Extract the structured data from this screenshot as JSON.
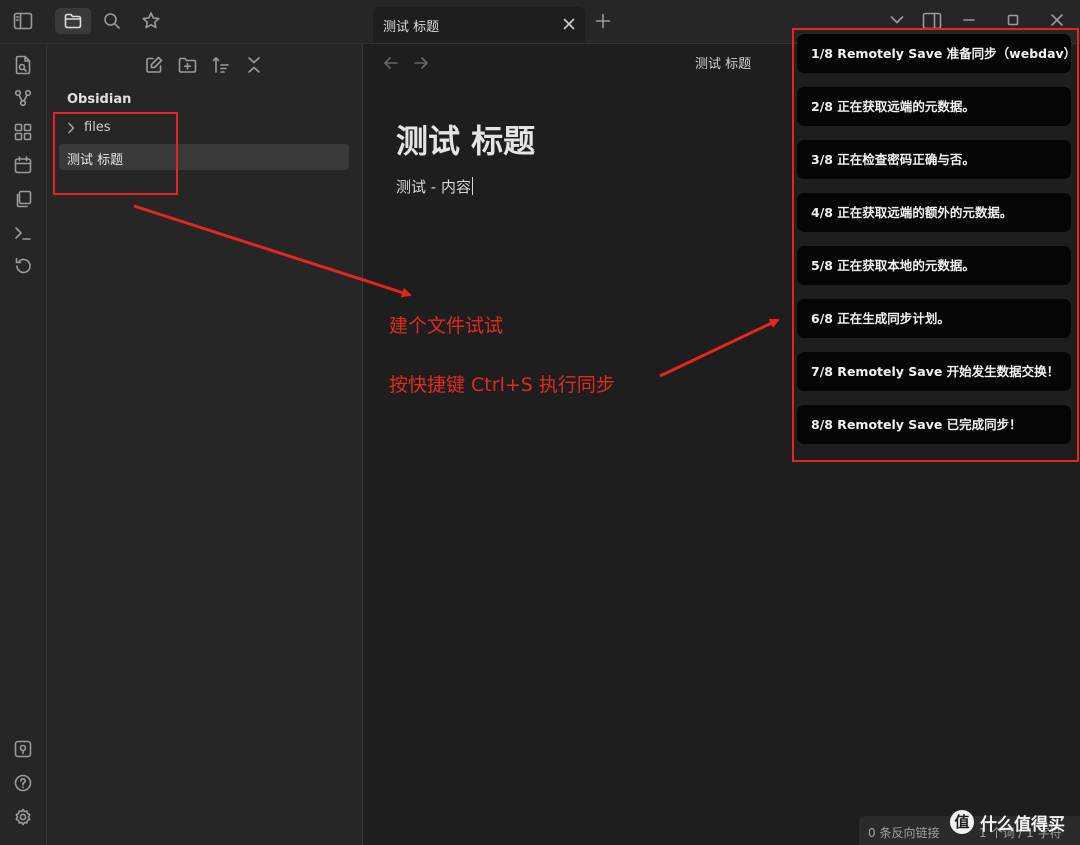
{
  "titlebar": {
    "tab_title": "测试 标题"
  },
  "explorer": {
    "vault_name": "Obsidian",
    "folder_label": "files",
    "active_file_label": "测试 标题"
  },
  "editor": {
    "view_title": "测试 标题",
    "note_heading": "测试 标题",
    "note_body": "测试 - 内容",
    "status_backlinks": "0 条反向链接",
    "status_words": "1 个词 / 1 字符"
  },
  "annotations": {
    "create_file": "建个文件试试",
    "shortcut": "按快捷键 Ctrl+S 执行同步",
    "color": "#e6261c"
  },
  "notices": [
    "1/8 Remotely Save 准备同步（webdav）",
    "2/8 正在获取远端的元数据。",
    "3/8 正在检查密码正确与否。",
    "4/8 正在获取远端的额外的元数据。",
    "5/8 正在获取本地的元数据。",
    "6/8 正在生成同步计划。",
    "7/8 Remotely Save 开始发生数据交换！",
    "8/8 Remotely Save 已完成同步！"
  ],
  "watermark": {
    "logo": "值",
    "text": "什么值得买"
  },
  "icons": {
    "ribbon_top": [
      "switcher-icon",
      "graph-icon",
      "canvas-icon",
      "daily-note-icon",
      "templates-icon",
      "command-palette-icon",
      "sync-icon"
    ],
    "ribbon_bottom": [
      "vault-icon",
      "help-icon",
      "settings-icon"
    ]
  }
}
